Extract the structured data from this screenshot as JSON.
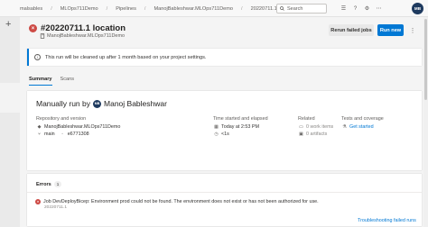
{
  "breadcrumbs": [
    "malsables",
    "MLOps711Demo",
    "Pipelines",
    "ManojBableshwar.MLOps711Demo",
    "20220711.1"
  ],
  "search": {
    "label": "Search"
  },
  "user": {
    "initials": "MB",
    "name": "Manoj Bableshwar"
  },
  "run": {
    "title": "#20220711.1 location",
    "subtitle": "ManojBableshwar.MLOps711Demo",
    "rerun_label": "Rerun failed jobs",
    "run_new_label": "Run new"
  },
  "banner": {
    "text": "This run will be cleaned up after 1 month based on your project settings."
  },
  "tabs": [
    {
      "label": "Summary",
      "active": true
    },
    {
      "label": "Scans",
      "active": false
    }
  ],
  "summary": {
    "manual_prefix": "Manually run by",
    "repo": {
      "label": "Repository and version",
      "repo_name": "ManojBableshwar.MLOps711Demo",
      "branch": "main",
      "commit": "e6771308"
    },
    "time": {
      "label": "Time started and elapsed",
      "started": "Today at 2:53 PM",
      "elapsed": "<1s"
    },
    "related": {
      "label": "Related",
      "work_items": "0 work items",
      "artifacts": "0 artifacts"
    },
    "tests": {
      "label": "Tests and coverage",
      "link": "Get started"
    }
  },
  "errors": {
    "title": "Errors",
    "count": "1",
    "message": "Job DevDeployBicep: Environment prod could not be found. The environment does not exist or has not been authorized for use.",
    "source": "20220711.1",
    "link": "Troubleshooting failed runs"
  },
  "colors": {
    "accent": "#0078d4",
    "error": "#cd4a45"
  },
  "icons": [
    "plus-icon",
    "search-icon",
    "list-icon",
    "help-icon",
    "settings-icon",
    "more-icon",
    "info-icon",
    "repo-icon",
    "branch-icon",
    "commit-icon",
    "calendar-icon",
    "clock-icon",
    "work-item-icon",
    "artifact-icon",
    "flask-icon",
    "error-icon"
  ]
}
